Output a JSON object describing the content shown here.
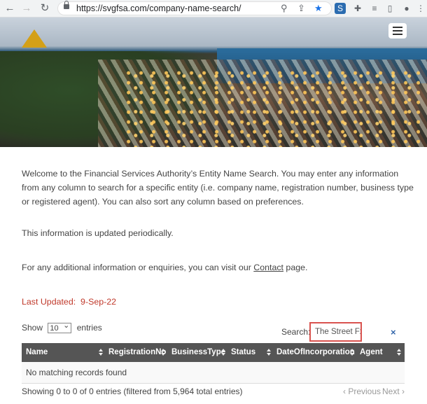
{
  "browser": {
    "url": "https://svgfsa.com/company-name-search/"
  },
  "intro": {
    "paragraph1": "Welcome to the Financial Services Authority’s Entity Name Search. You may enter any information from any column to search for a specific entity (i.e. company name, registration number, business type or registered agent). You can also sort any column based on preferences.",
    "paragraph2": "This information is updated periodically.",
    "paragraph3_prefix": "For any additional information or enquiries, you can visit our ",
    "contact_link": "Contact",
    "paragraph3_suffix": " page.",
    "last_updated_label": "Last Updated:",
    "last_updated_value": "9-Sep-22"
  },
  "table_controls": {
    "show_label": "Show",
    "entries_value": "10",
    "entries_label": "entries",
    "search_label": "Search:",
    "search_value": "The Street Fx",
    "clear_icon": "×"
  },
  "table": {
    "columns": [
      "Name",
      "RegistrationNo",
      "BusinessType",
      "Status",
      "DateOfIncorporation",
      "Agent"
    ],
    "empty_message": "No matching records found"
  },
  "footer": {
    "info": "Showing 0 to 0 of 0 entries (filtered from 5,964 total entries)",
    "previous": "Previous",
    "next": "Next"
  },
  "icons": [
    "back-arrow-icon",
    "forward-arrow-icon",
    "reload-icon",
    "lock-icon",
    "zoom-icon",
    "share-icon",
    "star-icon",
    "extension-icon",
    "puzzle-icon",
    "playlist-icon",
    "sidebar-icon",
    "profile-icon",
    "kebab-menu-icon",
    "hamburger-menu-icon",
    "clear-search-icon",
    "sort-icon"
  ],
  "colors": {
    "accent_red": "#c0392b",
    "table_header": "#555555",
    "search_highlight": "#d9534f"
  }
}
